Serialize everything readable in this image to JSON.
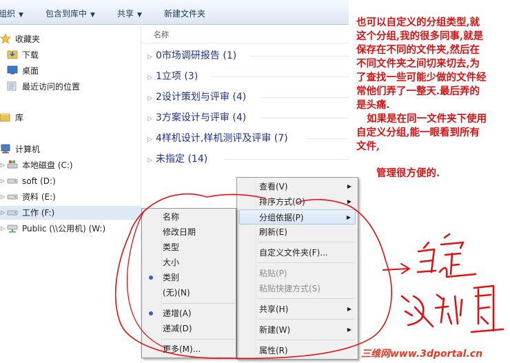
{
  "toolbar": {
    "organize": "组织",
    "include_in_library": "包含到库中",
    "share": "共享",
    "new_folder": "新建文件夹"
  },
  "nav": {
    "favorites": "收藏夹",
    "downloads": "下载",
    "desktop": "桌面",
    "recent": "最近访问的位置",
    "libraries": "库",
    "computer": "计算机",
    "drive_c": "本地磁盘 (C:)",
    "drive_d": "soft (D:)",
    "drive_e": "资料 (E:)",
    "drive_f": "工作 (F:)",
    "network_w": "Public (\\\\公用机) (W:)"
  },
  "content": {
    "column_name": "名称",
    "groups": [
      {
        "label": "0市场调研报告 (1)"
      },
      {
        "label": "1立项 (3)"
      },
      {
        "label": "2设计策划与评审 (4)"
      },
      {
        "label": "3方案设计与评审 (4)"
      },
      {
        "label": "4样机设计,样机测评及评审 (7)"
      },
      {
        "label": "未指定 (14)"
      }
    ]
  },
  "context_menu": {
    "view": "查看(V)",
    "sort_by": "排序方式(O)",
    "group_by": "分组依据(P)",
    "refresh": "刷新(E)",
    "customize_folder": "自定义文件夹(F)...",
    "paste": "粘贴(P)",
    "paste_shortcut": "粘贴快捷方式(S)",
    "share_with": "共享(H)",
    "new": "新建(W)",
    "properties": "属性(R)"
  },
  "group_submenu": {
    "name": "名称",
    "date_modified": "修改日期",
    "type": "类型",
    "size": "大小",
    "category": "类别",
    "none": "(无)(N)",
    "ascending": "递增(A)",
    "descending": "递减(D)",
    "more": "更多(M)..."
  },
  "annotation": {
    "lines": [
      "也可以自定义的分组类型,就",
      "这个分组,我的很多同事,就是",
      "保存在不同的文件夹,然后在",
      "不同文件夹之间切来切去,为",
      "了查找一些可能少做的文件经",
      "常他们弄了一整天.最后弄的",
      "是头痛.",
      "   如果是在同一文件夹下使用",
      "自定义分组,能一眼看到所有",
      "文件,"
    ],
    "footer": "管理很方便的.",
    "watermark": "三维网www.3dportal.cn"
  },
  "colors": {
    "annotation_red": "#d21414",
    "group_header_blue": "#1e3287",
    "toolbar_text": "#1e395b",
    "menu_bg": "#f0f0f0",
    "radio_dot": "#3a5fc8"
  }
}
